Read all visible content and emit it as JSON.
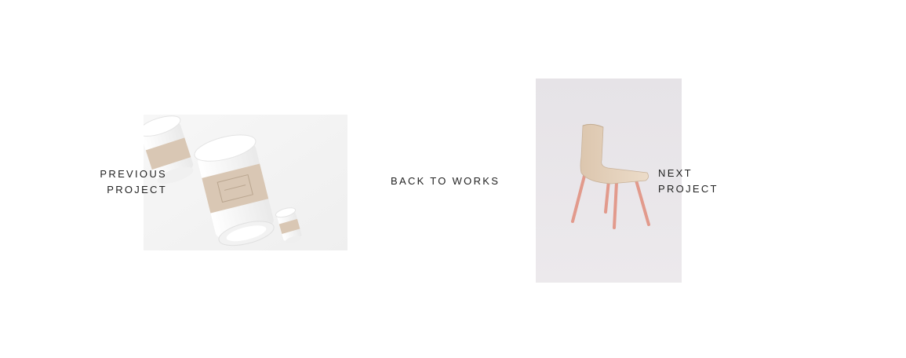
{
  "project_nav": {
    "previous": {
      "label_line1": "PREVIOUS",
      "label_line2": "PROJECT",
      "thumbnail": "coffee-cups-mockup"
    },
    "back": {
      "label": "BACK TO WORKS"
    },
    "next": {
      "label_line1": "NEXT",
      "label_line2": "PROJECT",
      "thumbnail": "wooden-chair-photo"
    }
  },
  "colors": {
    "background": "#ffffff",
    "text": "#222222",
    "cup_sleeve": "#d9c7b4",
    "chair_wood": "#e6d2bd",
    "chair_legs": "#e29a8c",
    "chair_backdrop": "#e8e6e9"
  }
}
